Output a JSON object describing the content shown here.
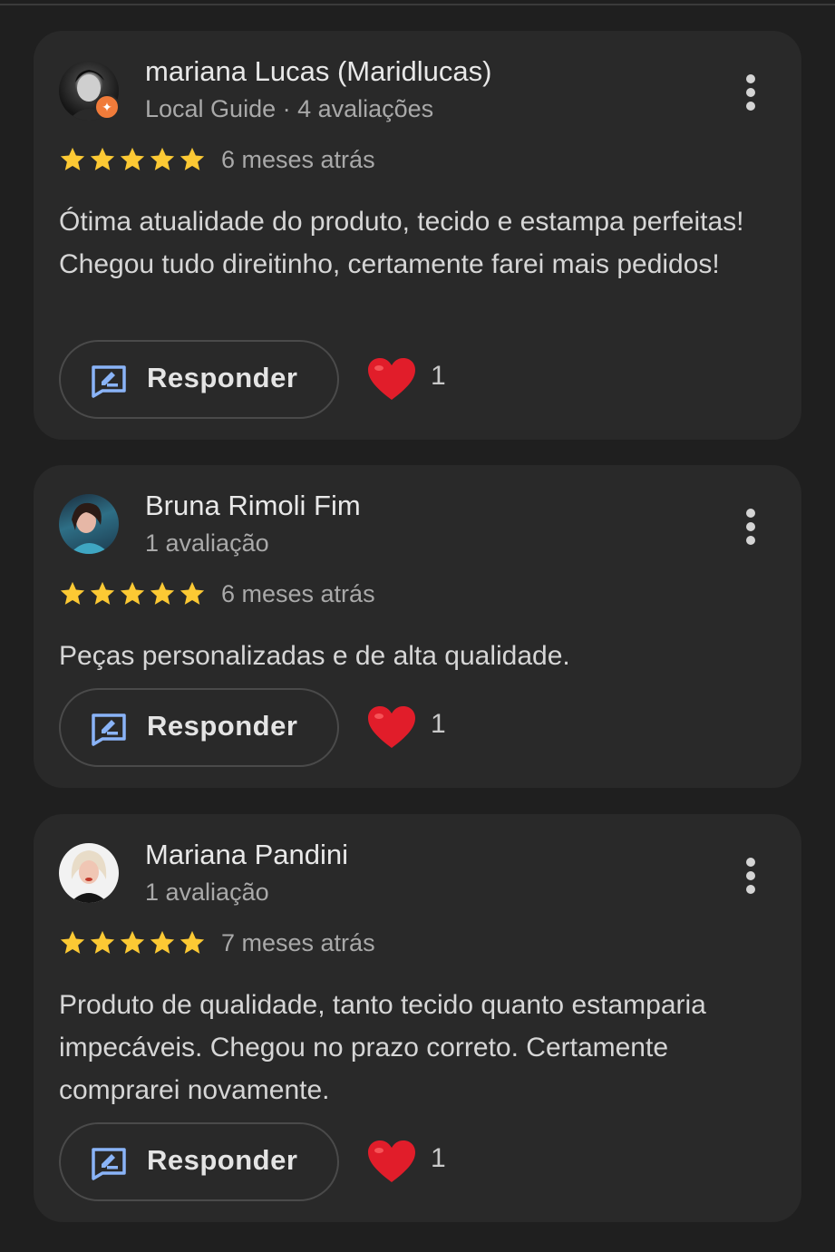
{
  "colors": {
    "background": "#1f1f1f",
    "card": "#292929",
    "star": "#fcc934",
    "heart": "#e11d2a",
    "reply_icon": "#8ab4f8",
    "local_guide_badge": "#f07b3a"
  },
  "reviews": [
    {
      "author": "mariana Lucas (Maridlucas)",
      "meta": "Local Guide · 4 avaliações",
      "rating": 5,
      "date": "6 meses atrás",
      "text": "Ótima atualidade do produto, tecido e estampa perfeitas! Chegou tudo direitinho, certamente farei mais pedidos!",
      "reply_label": "Responder",
      "likes": "1",
      "avatar_icon": "avatar-photo-icon",
      "badge_icon": "local-guide-badge-icon"
    },
    {
      "author": "Bruna Rimoli Fim",
      "meta": "1 avaliação",
      "rating": 5,
      "date": "6 meses atrás",
      "text": "Peças personalizadas e de alta qualidade.",
      "reply_label": "Responder",
      "likes": "1",
      "avatar_icon": "avatar-photo-icon"
    },
    {
      "author": "Mariana Pandini",
      "meta": "1 avaliação",
      "rating": 5,
      "date": "7 meses atrás",
      "text": "Produto de qualidade, tanto tecido quanto estamparia impecáveis. Chegou no prazo correto. Certamente comprarei novamente.",
      "reply_label": "Responder",
      "likes": "1",
      "avatar_icon": "avatar-photo-icon"
    }
  ]
}
